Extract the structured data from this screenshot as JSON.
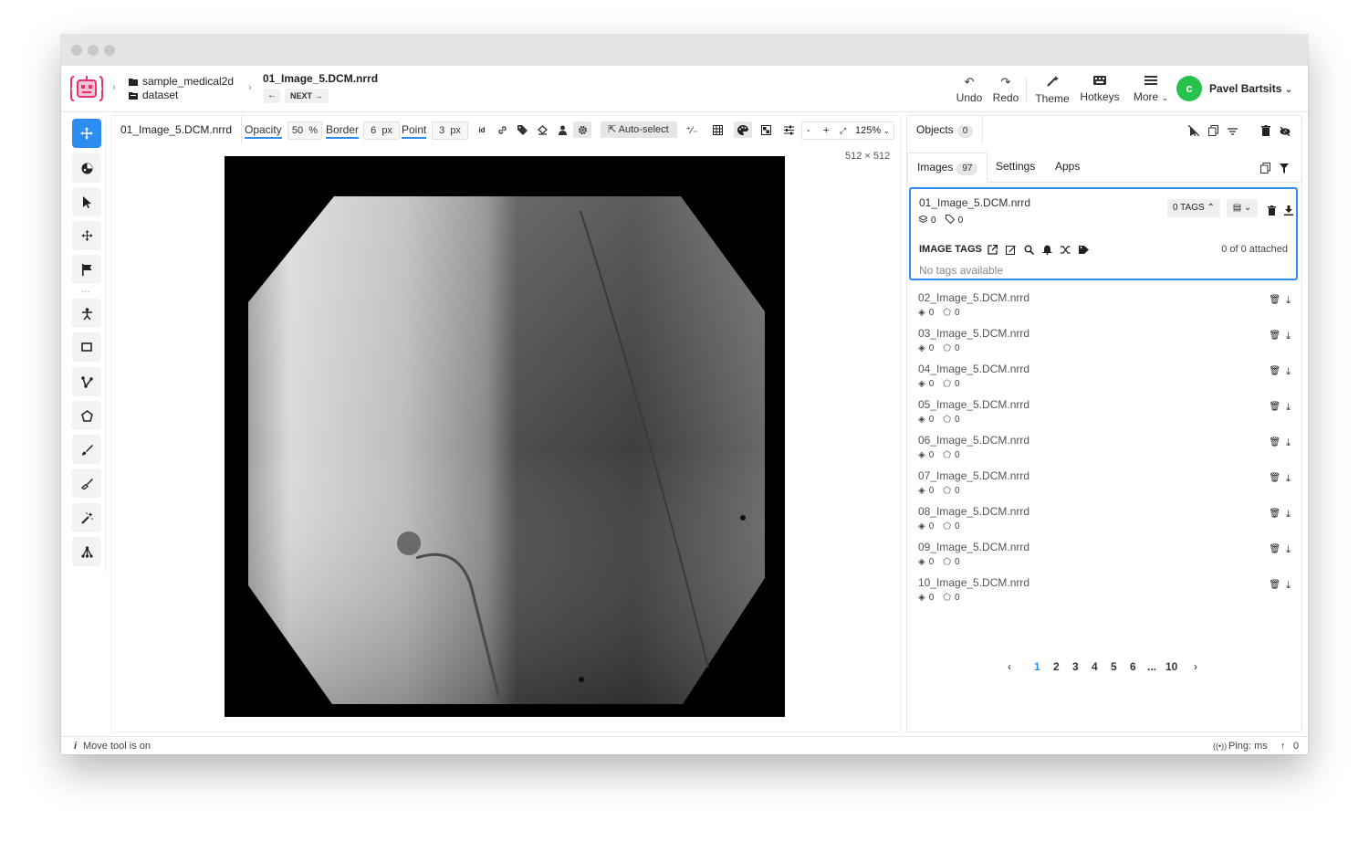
{
  "window": {
    "dots": 3
  },
  "breadcrumb": {
    "project": "sample_medical2d",
    "dataset": "dataset",
    "image_name": "01_Image_5.DCM.nrrd",
    "next_label": "NEXT"
  },
  "header": {
    "undo": "Undo",
    "redo": "Redo",
    "theme": "Theme",
    "hotkeys": "Hotkeys",
    "more": "More",
    "user_initial": "c",
    "user_name": "Pavel Bartsits",
    "avatar_color": "#27c24c"
  },
  "toolbar": {
    "tab_title": "01_Image_5.DCM.nrrd",
    "opacity_label": "Opacity",
    "opacity_value": "50",
    "opacity_unit": "%",
    "border_label": "Border",
    "border_value": "6",
    "border_unit": "px",
    "point_label": "Point",
    "point_value": "3",
    "point_unit": "px",
    "auto_select": "Auto-select",
    "zoom": "125%",
    "minus": "-",
    "plus": "+"
  },
  "canvas": {
    "dimensions": "512 × 512"
  },
  "objects": {
    "label": "Objects",
    "count": "0"
  },
  "tabs": {
    "images": "Images",
    "images_count": "97",
    "settings": "Settings",
    "apps": "Apps"
  },
  "selected_image": {
    "name": "01_Image_5.DCM.nrrd",
    "layers": "0",
    "tags": "0",
    "tags_button": "0 TAGS",
    "image_tags_label": "IMAGE TAGS",
    "attached": "0 of 0 attached",
    "empty_message": "No tags available"
  },
  "images": [
    {
      "name": "02_Image_5.DCM.nrrd",
      "layers": "0",
      "tags": "0"
    },
    {
      "name": "03_Image_5.DCM.nrrd",
      "layers": "0",
      "tags": "0"
    },
    {
      "name": "04_Image_5.DCM.nrrd",
      "layers": "0",
      "tags": "0"
    },
    {
      "name": "05_Image_5.DCM.nrrd",
      "layers": "0",
      "tags": "0"
    },
    {
      "name": "06_Image_5.DCM.nrrd",
      "layers": "0",
      "tags": "0"
    },
    {
      "name": "07_Image_5.DCM.nrrd",
      "layers": "0",
      "tags": "0"
    },
    {
      "name": "08_Image_5.DCM.nrrd",
      "layers": "0",
      "tags": "0"
    },
    {
      "name": "09_Image_5.DCM.nrrd",
      "layers": "0",
      "tags": "0"
    },
    {
      "name": "10_Image_5.DCM.nrrd",
      "layers": "0",
      "tags": "0"
    }
  ],
  "pagination": {
    "pages": [
      "1",
      "2",
      "3",
      "4",
      "5",
      "6"
    ],
    "ellipsis": "...",
    "last": "10",
    "current": "1"
  },
  "status": {
    "info_icon": "i",
    "message": "Move tool is on",
    "ping": "Ping: ms",
    "upload_count": "0"
  },
  "colors": {
    "accent": "#2d8cf0",
    "logo": "#e8336d"
  }
}
